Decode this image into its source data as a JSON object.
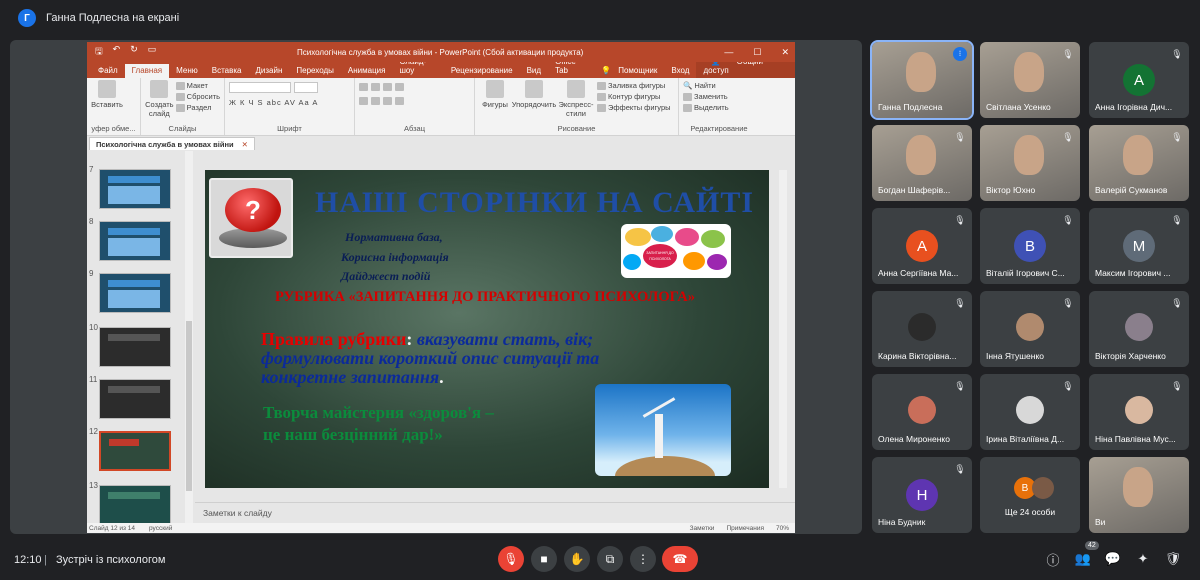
{
  "topbar": {
    "presenter_initial": "Г",
    "title": "Ганна Подлесна на екрані"
  },
  "ppt": {
    "window_title": "Психологічна служба в умовах війни - PowerPoint (Сбой активации продукта)",
    "window_buttons": [
      "—",
      "☐",
      "✕"
    ],
    "tabs": [
      "Файл",
      "Главная",
      "Меню",
      "Вставка",
      "Дизайн",
      "Переходы",
      "Анимация",
      "Слайд-шоу",
      "Рецензирование",
      "Вид",
      "Office Tab"
    ],
    "active_tab": "Главная",
    "help": "Помощник",
    "login": "Вход",
    "share": "Общий доступ",
    "ribbon": {
      "paste": "Вставить",
      "clipboard": "уфер обме...",
      "create_slide": "Создать слайд",
      "layout": "Макет",
      "reset": "Сбросить",
      "section": "Раздел",
      "slides": "Слайды",
      "font": "Шрифт",
      "paragraph": "Абзац",
      "shapes": "Фигуры",
      "arrange": "Упорядочить",
      "express_styles": "Экспресс-стили",
      "fill": "Заливка фигуры",
      "outline": "Контур фигуры",
      "effects": "Эффекты фигуры",
      "drawing": "Рисование",
      "find": "Найти",
      "replace": "Заменить",
      "select": "Выделить",
      "editing": "Редактирование",
      "font_format": "Ж К Ч S abc AV Aa A"
    },
    "doc_tab": "Психологічна служба в умовах війни",
    "doc_tab_close": "✕",
    "thumb_numbers": [
      "7",
      "8",
      "9",
      "10",
      "11",
      "12",
      "13"
    ],
    "notes": "Заметки к слайду",
    "status_left": "Слайд 12 из 14",
    "status_lang": "русский",
    "status_notes": "Заметки",
    "status_comments": "Примечания",
    "zoom": "70%"
  },
  "slide": {
    "heading": "НАШІ СТОРІНКИ НА САЙТІ",
    "menu": [
      "Нормативна база,",
      "Корисна інформація",
      "Дайджест подій"
    ],
    "bubble_text": "ЗАПИТАННЯ ДО ПСИХОЛОГА",
    "rubric": "РУБРИКА «ЗАПИТАННЯ ДО ПРАКТИЧНОГО ПСИХОЛОГА»",
    "rules_label": "Правила рубрики",
    "rules_colon": ":",
    "rules_text1": " вказувати стать, вік;",
    "rules_text2": "формулювати короткий опис ситуації та конкретне запитання",
    "rules_end": ".",
    "creative_line1": "Творча майстерня «здоров'я –",
    "creative_line2": " це наш безцінний дар!»"
  },
  "participants": [
    {
      "name": "Ганна Подлесна",
      "type": "video",
      "speaking": true
    },
    {
      "name": "Світлана Усенко",
      "type": "video",
      "muted": true
    },
    {
      "name": "Анна Ігорівна Дич...",
      "type": "avatar",
      "initial": "А",
      "color": "#137333",
      "muted": true
    },
    {
      "name": "Богдан Шаферів...",
      "type": "video",
      "muted": true
    },
    {
      "name": "Віктор Юхно",
      "type": "video",
      "muted": true
    },
    {
      "name": "Валерій Сукманов",
      "type": "video",
      "muted": true
    },
    {
      "name": "Анна Сергіївна Ма...",
      "type": "avatar",
      "initial": "А",
      "color": "#e8501f",
      "muted": true
    },
    {
      "name": "Віталій Ігорович С...",
      "type": "avatar",
      "initial": "В",
      "color": "#3f51b5",
      "muted": true
    },
    {
      "name": "Максим Ігорович ...",
      "type": "avatar",
      "initial": "М",
      "color": "#5f6b78",
      "muted": true
    },
    {
      "name": "Карина Вікторівна...",
      "type": "photo",
      "color": "#2b2b2b",
      "muted": true
    },
    {
      "name": "Інна Ятушенко",
      "type": "photo",
      "color": "#b08a6e",
      "muted": true
    },
    {
      "name": "Вікторія Харченко",
      "type": "photo",
      "color": "#8a7f8c",
      "muted": true
    },
    {
      "name": "Олена Мироненко",
      "type": "photo",
      "color": "#c96e5a",
      "muted": true
    },
    {
      "name": "Ірина Віталіївна Д...",
      "type": "photo",
      "color": "#d8d8d8",
      "muted": true
    },
    {
      "name": "Ніна Павлівна Мус...",
      "type": "photo",
      "color": "#d9b8a0",
      "muted": true
    },
    {
      "name": "Ніна Будник",
      "type": "avatar",
      "initial": "Н",
      "color": "#5e35b1",
      "muted": true
    },
    {
      "name": "Ще 24 особи",
      "type": "others",
      "initial": "В"
    },
    {
      "name": "Ви",
      "type": "video"
    }
  ],
  "bottombar": {
    "time": "12:10",
    "separator": "|",
    "meeting": "Зустріч із психологом",
    "participants_count": "42"
  }
}
